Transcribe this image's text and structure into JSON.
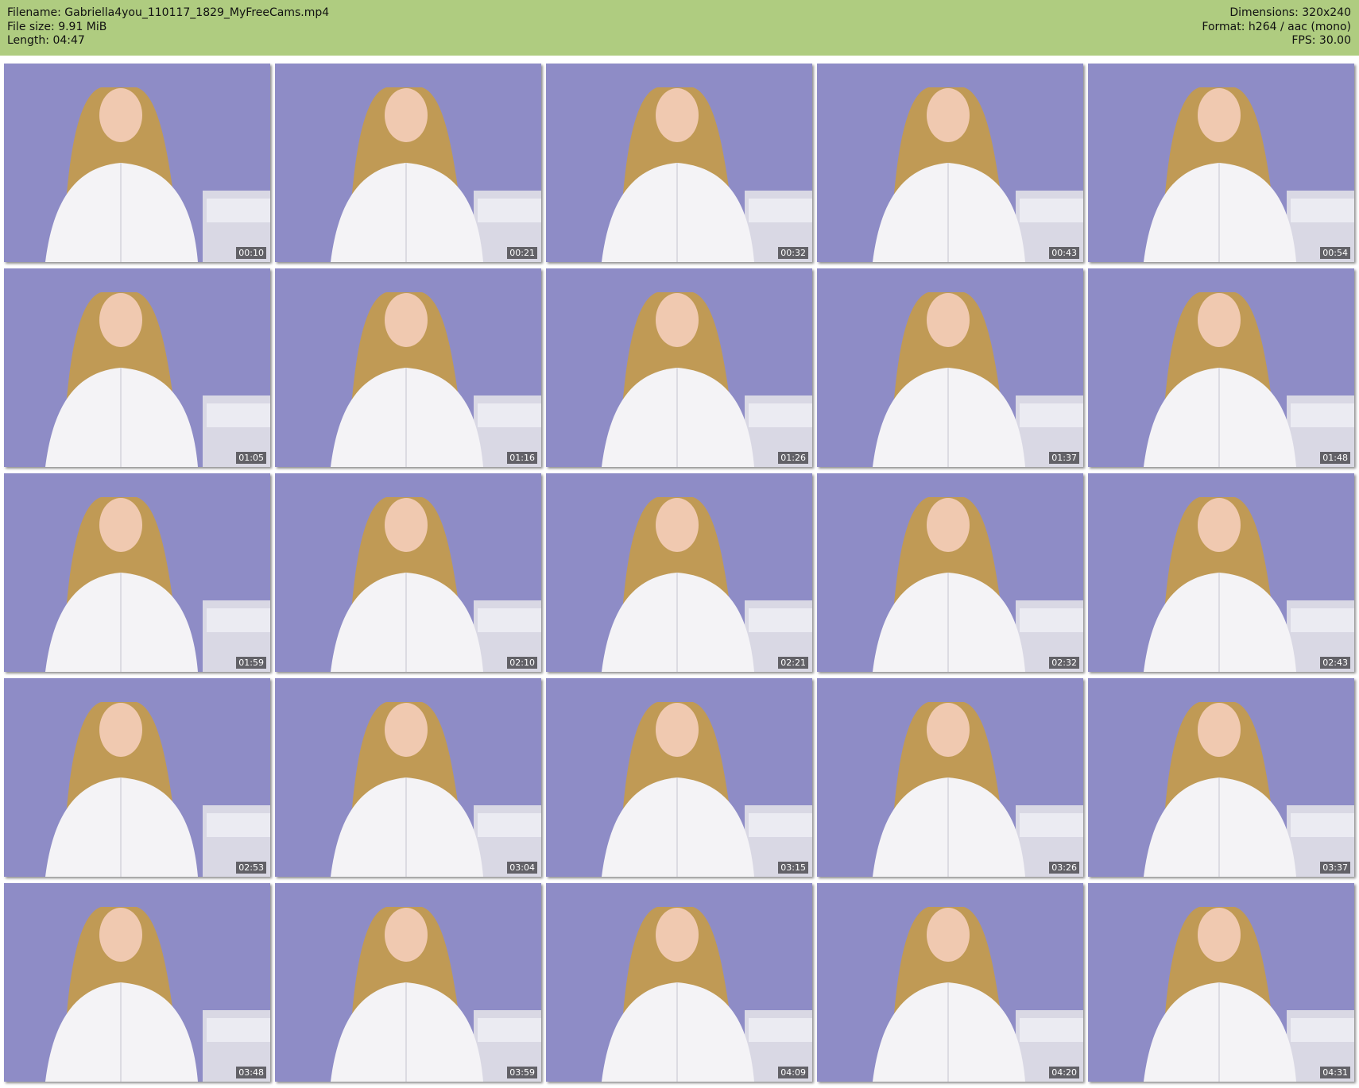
{
  "header": {
    "filename": "Filename: Gabriella4you_110117_1829_MyFreeCams.mp4",
    "file_size": "File size: 9.91 MiB",
    "length": "Length: 04:47",
    "dimensions": "Dimensions: 320x240",
    "format": "Format: h264 / aac (mono)",
    "fps": "FPS: 30.00"
  },
  "colors": {
    "header_bg": "#afcc80",
    "wall": "#8e8cc6",
    "shirt": "#f4f3f6",
    "hair": "#c09a55"
  },
  "thumbnails": [
    {
      "timestamp": "00:10"
    },
    {
      "timestamp": "00:21"
    },
    {
      "timestamp": "00:32"
    },
    {
      "timestamp": "00:43"
    },
    {
      "timestamp": "00:54"
    },
    {
      "timestamp": "01:05"
    },
    {
      "timestamp": "01:16"
    },
    {
      "timestamp": "01:26"
    },
    {
      "timestamp": "01:37"
    },
    {
      "timestamp": "01:48"
    },
    {
      "timestamp": "01:59"
    },
    {
      "timestamp": "02:10"
    },
    {
      "timestamp": "02:21"
    },
    {
      "timestamp": "02:32"
    },
    {
      "timestamp": "02:43"
    },
    {
      "timestamp": "02:53"
    },
    {
      "timestamp": "03:04"
    },
    {
      "timestamp": "03:15"
    },
    {
      "timestamp": "03:26"
    },
    {
      "timestamp": "03:37"
    },
    {
      "timestamp": "03:48"
    },
    {
      "timestamp": "03:59"
    },
    {
      "timestamp": "04:09"
    },
    {
      "timestamp": "04:20"
    },
    {
      "timestamp": "04:31"
    }
  ]
}
